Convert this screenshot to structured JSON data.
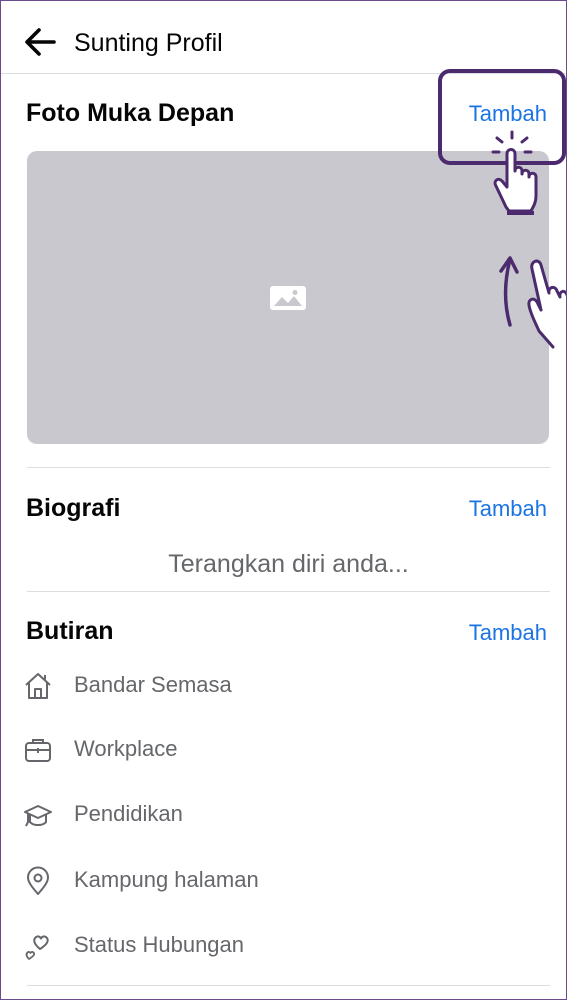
{
  "header": {
    "back_icon": "arrow-left-icon",
    "title": "Sunting Profil"
  },
  "cover_section": {
    "title": "Foto Muka Depan",
    "add_label": "Tambah",
    "placeholder_icon": "image-icon"
  },
  "bio_section": {
    "title": "Biografi",
    "add_label": "Tambah",
    "placeholder": "Terangkan diri anda..."
  },
  "details_section": {
    "title": "Butiran",
    "add_label": "Tambah",
    "items": [
      {
        "icon": "home-icon",
        "label": "Bandar Semasa"
      },
      {
        "icon": "briefcase-icon",
        "label": "Workplace"
      },
      {
        "icon": "graduation-cap-icon",
        "label": "Pendidikan"
      },
      {
        "icon": "location-pin-icon",
        "label": "Kampung halaman"
      },
      {
        "icon": "hearts-icon",
        "label": "Status Hubungan"
      }
    ]
  },
  "colors": {
    "link": "#1b74e4",
    "cover_placeholder": "#c9c8ce",
    "annotation": "#4b2a6e"
  }
}
